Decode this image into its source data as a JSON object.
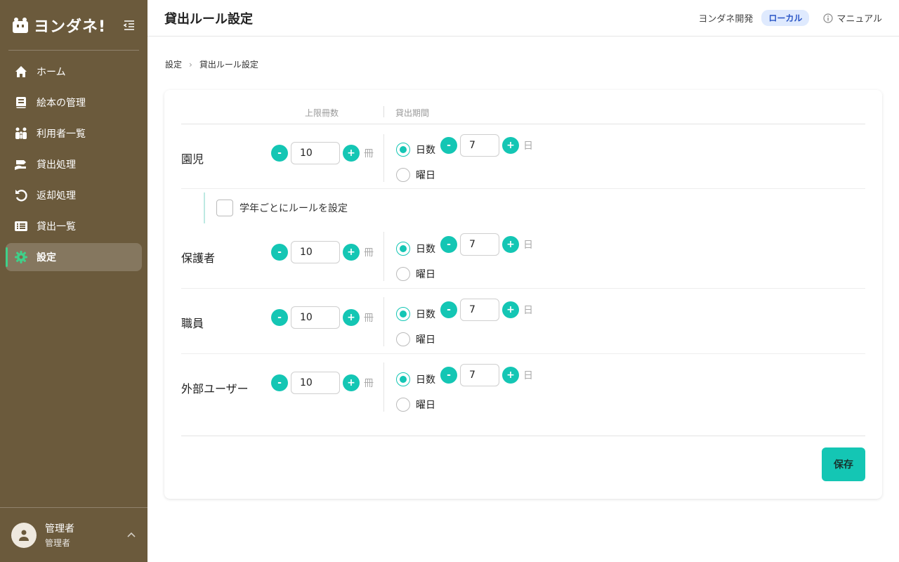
{
  "app": {
    "logo_text": "ヨンダネ!"
  },
  "sidebar": {
    "items": [
      {
        "label": "ホーム",
        "icon": "home-icon"
      },
      {
        "label": "絵本の管理",
        "icon": "book-icon"
      },
      {
        "label": "利用者一覧",
        "icon": "users-icon"
      },
      {
        "label": "貸出処理",
        "icon": "hand-lend-icon"
      },
      {
        "label": "返却処理",
        "icon": "return-icon"
      },
      {
        "label": "貸出一覧",
        "icon": "list-icon"
      },
      {
        "label": "設定",
        "icon": "gear-icon",
        "active": true
      }
    ],
    "user": {
      "name": "管理者",
      "role": "管理者"
    }
  },
  "header": {
    "title": "貸出ルール設定",
    "org": "ヨンダネ開発",
    "env_badge": "ローカル",
    "manual": "マニュアル"
  },
  "breadcrumb": {
    "parent": "設定",
    "current": "貸出ルール設定"
  },
  "rules": {
    "col_limit": "上限冊数",
    "col_period": "貸出期間",
    "unit_books": "冊",
    "unit_days": "日",
    "opt_days": "日数",
    "opt_weekday": "曜日",
    "grade_checkbox_label": "学年ごとにルールを設定",
    "rows": [
      {
        "label": "園児",
        "limit": "10",
        "days": "7"
      },
      {
        "label": "保護者",
        "limit": "10",
        "days": "7"
      },
      {
        "label": "職員",
        "limit": "10",
        "days": "7"
      },
      {
        "label": "外部ユーザー",
        "limit": "10",
        "days": "7"
      }
    ],
    "minus": "-",
    "plus": "+",
    "save": "保存"
  },
  "colors": {
    "sidebar": "#6b5a3c",
    "accent": "#14c6b4",
    "active_indicator": "#3fd08a",
    "badge_bg": "#dfeafe"
  }
}
